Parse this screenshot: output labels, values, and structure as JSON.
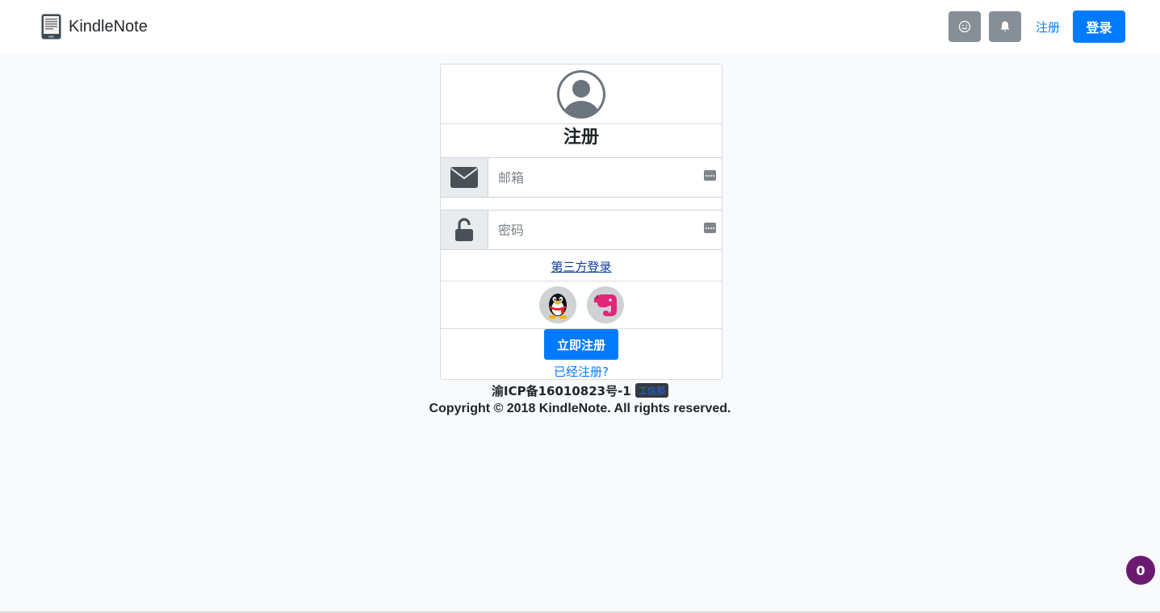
{
  "navbar": {
    "brand_name": "KindleNote",
    "brand_icon": "kindle-icon",
    "emoji_icon": "smiley-icon",
    "bell_icon": "bell-icon",
    "register_link": "注册",
    "login_button": "登录"
  },
  "card": {
    "avatar_icon": "user-circle-icon",
    "title": "注册",
    "email": {
      "icon": "envelope-icon",
      "placeholder": "邮箱",
      "value": ""
    },
    "password": {
      "icon": "unlock-icon",
      "placeholder": "密码",
      "value": ""
    },
    "third_party_link": "第三方登录",
    "social": [
      {
        "name": "qq",
        "icon": "qq-penguin-icon"
      },
      {
        "name": "evernote",
        "icon": "evernote-elephant-icon"
      }
    ],
    "register_button": "立即注册",
    "already_registered_link": "已经注册?"
  },
  "footer": {
    "icp_text": "渝ICP备16010823号-1",
    "icp_badge": "工信部",
    "copyright": "Copyright © 2018 KindleNote. All rights reserved."
  },
  "counter_badge": "0",
  "colors": {
    "primary": "#007bff",
    "secondary": "#868e96",
    "counter": "#6a1b71",
    "background": "#f8fafc"
  }
}
